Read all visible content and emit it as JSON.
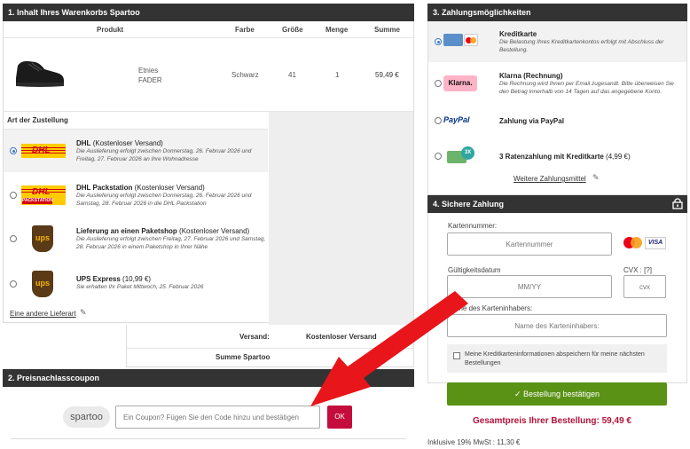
{
  "cart": {
    "header": "1. Inhalt Ihres Warenkorbs Spartoo",
    "columns": {
      "product": "Produkt",
      "color": "Farbe",
      "size": "Größe",
      "quantity": "Menge",
      "sum": "Summe"
    },
    "item": {
      "brand": "Etnies",
      "name": "FADER",
      "color": "Schwarz",
      "size": "41",
      "quantity": "1",
      "price": "59,49 €"
    }
  },
  "delivery": {
    "header": "Art der Zustellung",
    "options": [
      {
        "title": "DHL",
        "note": "(Kostenloser Versand)",
        "desc1": "Die Auslieferung erfolgt zwischen Donnerstag, 26. Februar 2026 und",
        "desc2": "Freitag, 27. Februar 2026 an Ihre Wohnadresse",
        "logo_text": "DHL"
      },
      {
        "title": "DHL Packstation",
        "note": "(Kostenloser Versand)",
        "desc1": "Die Auslieferung erfolgt zwischen Donnerstag, 26. Februar 2026 und",
        "desc2": "Samstag, 28. Februar 2026 in die DHL Packstation",
        "logo_text": "DHL",
        "logo_sub": "PACKSTATION"
      },
      {
        "title": "Lieferung an einen Paketshop",
        "note": "(Kostenloser Versand)",
        "desc1": "Die Auslieferung erfolgt zwischen Freitag, 27. Februar 2026 und Samstag,",
        "desc2": "28. Februar 2026 in einem Paketshop in Ihrer Nähe",
        "logo_text": "ups"
      },
      {
        "title": "UPS Express",
        "note": "(10,99 €)",
        "desc1": "Sie erhalten Ihr Paket Mittwoch, 25. Februar 2026",
        "desc2": "",
        "logo_text": "ups"
      }
    ],
    "other_link": "Eine andere Lieferart"
  },
  "totals": {
    "shipping_label": "Versand:",
    "shipping_value": "Kostenloser Versand",
    "sum_label": "Summe Spartoo"
  },
  "coupon": {
    "header": "2. Preisnachlasscoupon",
    "logo": "spartoo",
    "placeholder": "Ein Coupon? Fügen Sie den Code hinzu und bestätigen",
    "ok": "OK"
  },
  "payment": {
    "header": "3. Zahlungsmöglichkeiten",
    "options": [
      {
        "title": "Kreditkarte",
        "desc1": "Die Belastung Ihres Kreditkartenkontos erfolgt mit Abschluss der",
        "desc2": "Bestellung."
      },
      {
        "title": "Klarna (Rechnung)",
        "desc1": "Die Rechnung wird Ihnen per Email zugesandt. Bitte überweisen Sie",
        "desc2": "den Betrag innerhalb von 14 Tagen auf das angegebene Konto.",
        "logo": "Klarna."
      },
      {
        "title": "Zahlung via PayPal",
        "logo": "PayPal"
      },
      {
        "title": "3 Ratenzahlung mit Kreditkarte",
        "note": "(4,99 €)",
        "badge": "3X"
      }
    ],
    "more_link": "Weitere Zahlungsmittel"
  },
  "secure": {
    "header": "4. Sichere Zahlung",
    "card_number_label": "Kartennummer:",
    "card_number_placeholder": "Kartennummer",
    "expiry_label": "Gültigkeitsdatum",
    "expiry_placeholder": "MM/YY",
    "cvx_label": "CVX : [?]",
    "cvx_placeholder": "cvx",
    "holder_label": "Name des Karteninhabers:",
    "holder_placeholder": "Name des Karteninhabers:",
    "save_checkbox": "Meine Kreditkarteninformationen abspeichern für meine nächsten Bestellungen",
    "confirm_button": "✓ Bestellung bestätigen",
    "total": "Gesamtpreis Ihrer Bestellung: 59,49 €",
    "vat": "Inklusive 19% MwSt : 11,30 €"
  },
  "colors": {
    "header_bg": "#333333",
    "confirm_green": "#5a9216",
    "total_red": "#b3123a",
    "ok_red": "#c40d3c",
    "arrow_red": "#e8151b"
  }
}
